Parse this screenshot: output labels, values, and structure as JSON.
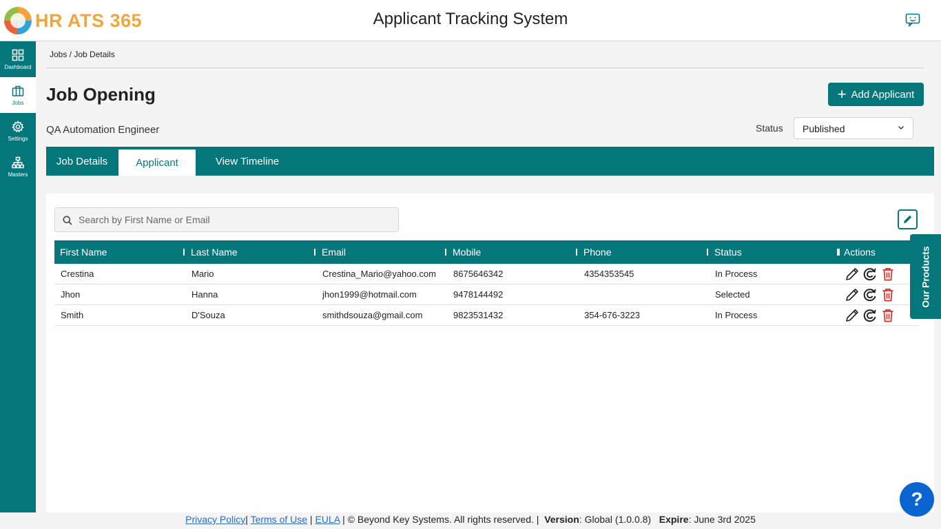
{
  "header": {
    "logo_text": "HR ATS 365",
    "title": "Applicant Tracking System"
  },
  "sidebar": {
    "items": [
      {
        "label": "Dashboard",
        "icon": "grid-icon"
      },
      {
        "label": "Jobs",
        "icon": "briefcase-icon"
      },
      {
        "label": "Settings",
        "icon": "gear-icon"
      },
      {
        "label": "Masters",
        "icon": "hierarchy-icon"
      }
    ],
    "active": "Jobs"
  },
  "breadcrumb": "Jobs / Job Details",
  "page": {
    "title": "Job Opening",
    "job_name": "QA Automation Engineer",
    "add_button_label": "Add Applicant",
    "status_label": "Status",
    "status_value": "Published"
  },
  "tabs": [
    {
      "label": "Job Details"
    },
    {
      "label": "Applicant"
    },
    {
      "label": "View Timeline"
    }
  ],
  "active_tab": "Applicant",
  "search": {
    "placeholder": "Search by First Name or Email"
  },
  "table": {
    "columns": [
      "First Name",
      "Last Name",
      "Email",
      "Mobile",
      "Phone",
      "Status",
      "Actions"
    ],
    "rows": [
      [
        "Crestina",
        "Mario",
        "Crestina_Mario@yahoo.com",
        "8675646342",
        "4354353545",
        "In Process"
      ],
      [
        "Jhon",
        "Hanna",
        "jhon1999@hotmail.com",
        "9478144492",
        "",
        "Selected"
      ],
      [
        "Smith",
        "D'Souza",
        "smithdsouza@gmail.com",
        "9823531432",
        "354-676-3223",
        "In Process"
      ]
    ]
  },
  "side_tab": "Our Products",
  "help_label": "?",
  "footer": {
    "privacy": "Privacy Policy",
    "terms": "Terms of Use",
    "eula": "EULA",
    "copyright": "| © Beyond Key Systems. All rights reserved. |",
    "version_label": "Version",
    "version_value": ": Global (1.0.0.8)",
    "expire_label": "Expire",
    "expire_value": ": June 3rd 2025"
  },
  "colors": {
    "primary": "#05777b",
    "delete": "#d9302c",
    "help": "#0a64d0",
    "logo_text": "#f0a63f"
  }
}
